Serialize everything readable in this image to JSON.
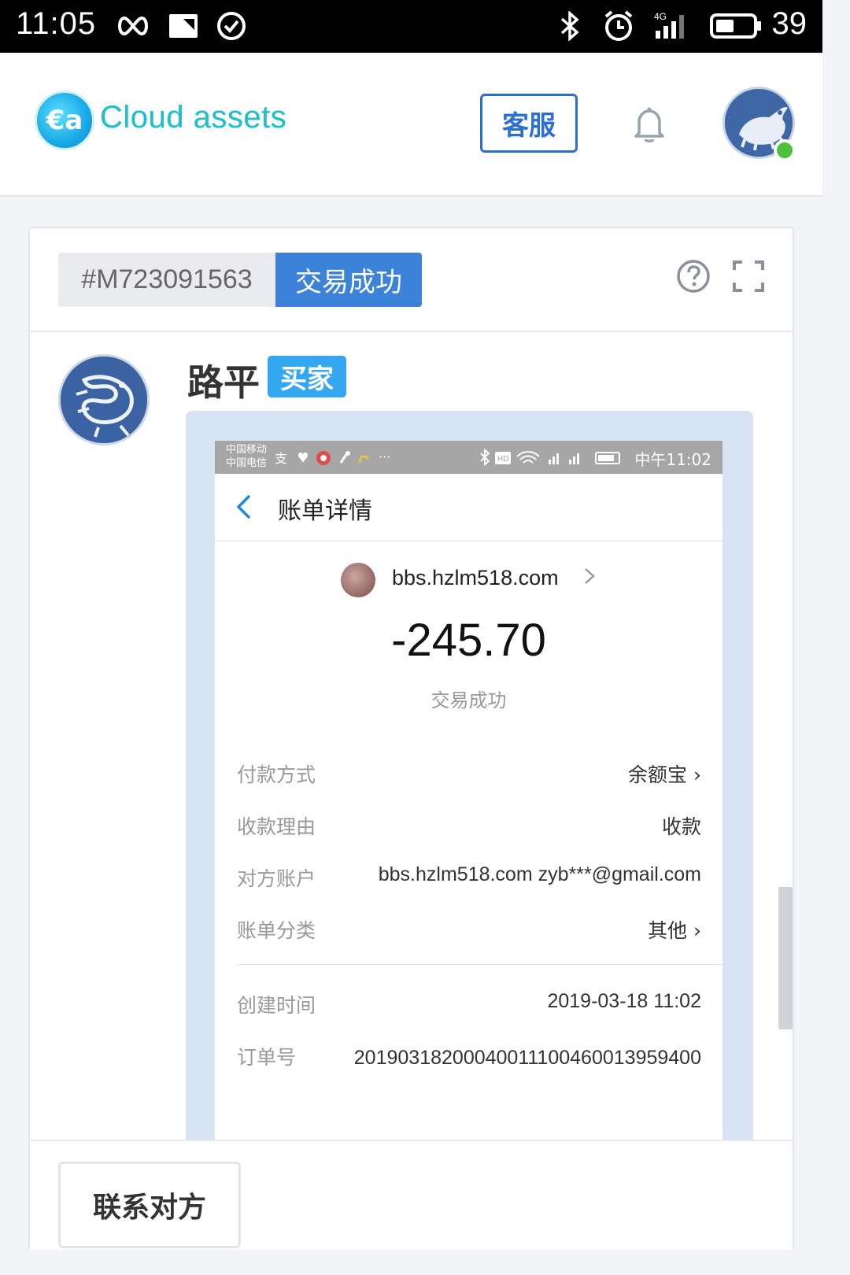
{
  "status_bar": {
    "time": "11:05",
    "battery": "39",
    "network": "4G"
  },
  "header": {
    "logo_symbol": "€a",
    "app_name": "Cloud assets",
    "customer_service": "客服",
    "bell_icon": "bell-icon",
    "online_status_color": "#4cc23c"
  },
  "order": {
    "id": "#M723091563",
    "status": "交易成功"
  },
  "user": {
    "name": "路平",
    "role": "买家"
  },
  "receipt": {
    "carrier_top": "中国移动",
    "carrier_bottom": "中国电信",
    "time": "中午11:02",
    "title": "账单详情",
    "merchant": "bbs.hzlm518.com",
    "amount": "-245.70",
    "status": "交易成功",
    "rows": [
      {
        "label": "付款方式",
        "value": "余额宝 ›"
      },
      {
        "label": "收款理由",
        "value": "收款"
      },
      {
        "label": "对方账户",
        "value": "bbs.hzlm518.com zyb***@gmail.com"
      },
      {
        "label": "账单分类",
        "value": "其他 ›"
      },
      {
        "label": "创建时间",
        "value": "2019-03-18 11:02"
      },
      {
        "label": "订单号",
        "value": "20190318200040011100460013959400"
      }
    ]
  },
  "footer": {
    "contact_button": "联系对方"
  },
  "colors": {
    "accent": "#3b82d8",
    "badge": "#34a7f0",
    "brand": "#1fc0c9"
  }
}
